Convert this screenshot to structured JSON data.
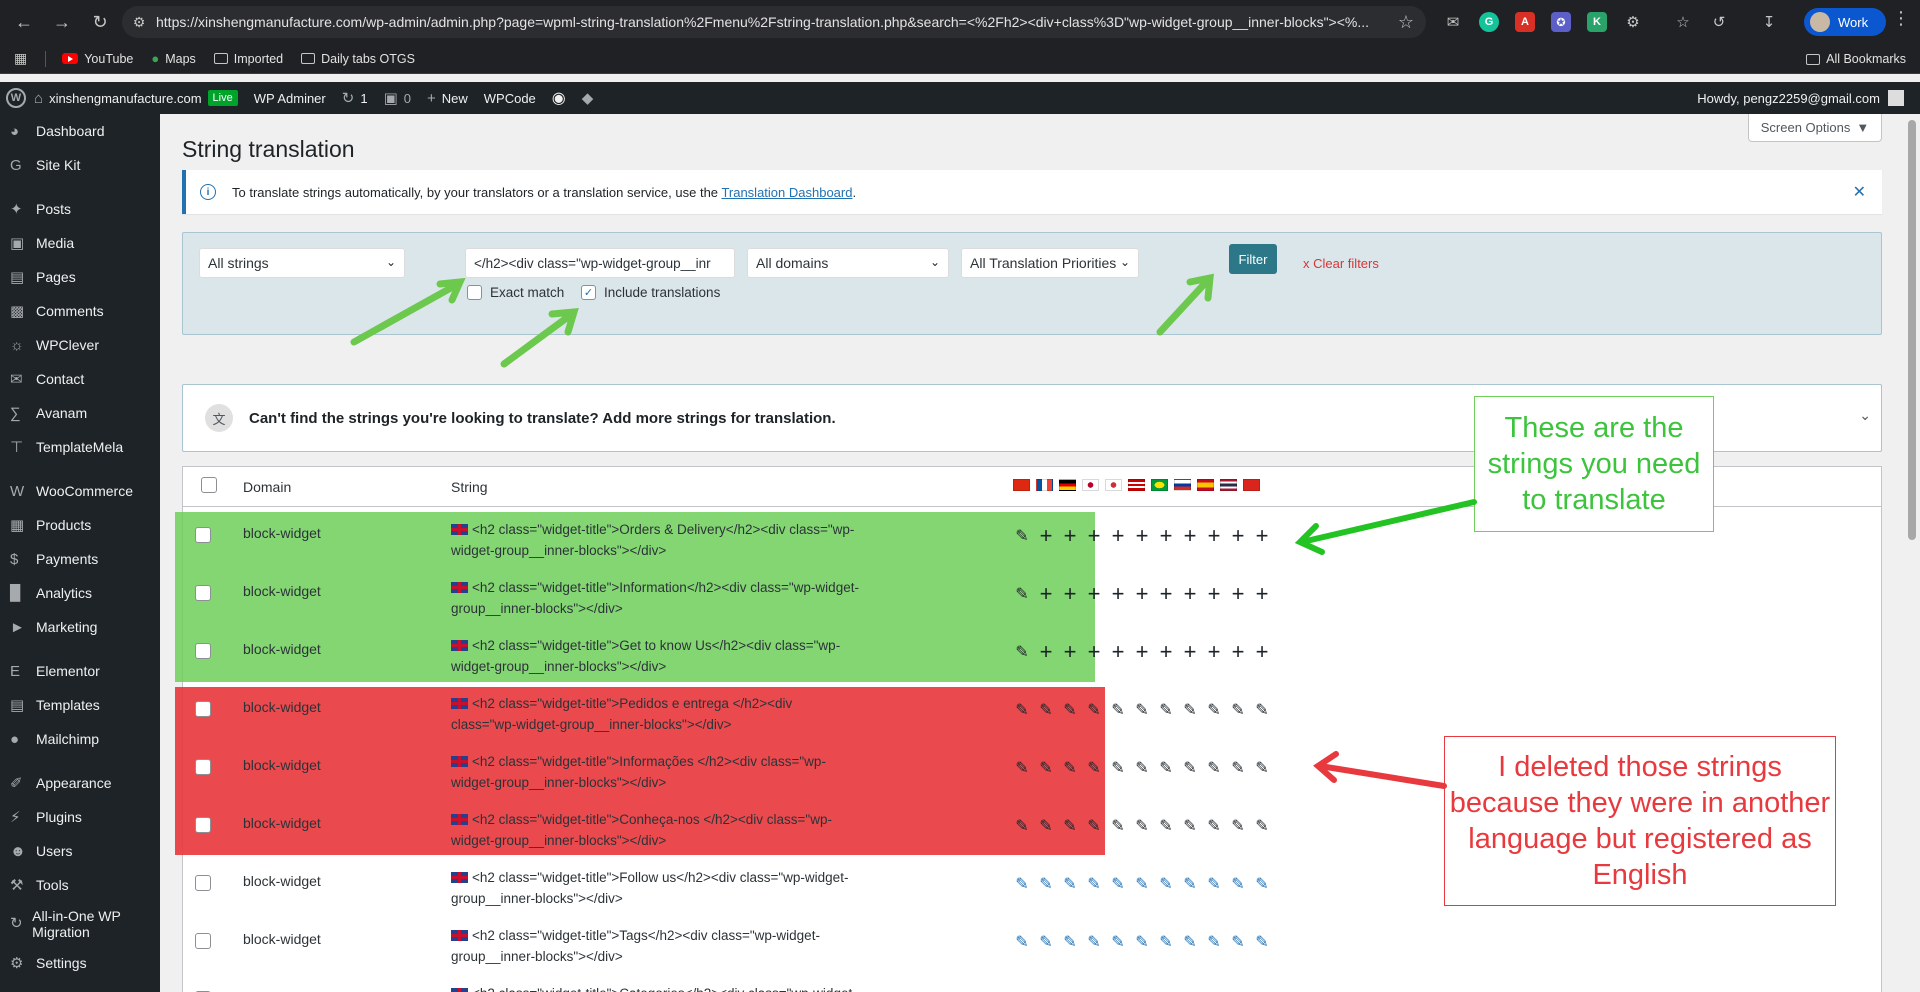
{
  "browser": {
    "url": "https://xinshengmanufacture.com/wp-admin/admin.php?page=wpml-string-translation%2Fmenu%2Fstring-translation.php&search=<%2Fh2><div+class%3D\"wp-widget-group__inner-blocks\"><%...",
    "profile_label": "Work",
    "bookmarks": [
      "YouTube",
      "Maps",
      "Imported",
      "Daily tabs OTGS"
    ],
    "all_bookmarks": "All Bookmarks"
  },
  "adminbar": {
    "site": "xinshengmanufacture.com",
    "live": "Live",
    "wp_adminer": "WP Adminer",
    "updates_count": "1",
    "comments_count": "0",
    "new_label": "New",
    "wpcode": "WPCode",
    "howdy": "Howdy, pengz2259@gmail.com"
  },
  "sidebar": {
    "items": [
      {
        "label": "Dashboard",
        "icon": "dashboard-icon"
      },
      {
        "label": "Site Kit",
        "icon": "sitekit-icon"
      },
      {
        "label": "Posts",
        "icon": "pin-icon"
      },
      {
        "label": "Media",
        "icon": "media-icon"
      },
      {
        "label": "Pages",
        "icon": "pages-icon"
      },
      {
        "label": "Comments",
        "icon": "comment-icon"
      },
      {
        "label": "WPClever",
        "icon": "lightbulb-icon"
      },
      {
        "label": "Contact",
        "icon": "mail-icon"
      },
      {
        "label": "Avanam",
        "icon": "avanam-icon"
      },
      {
        "label": "TemplateMela",
        "icon": "templatemela-icon"
      },
      {
        "label": "WooCommerce",
        "icon": "woo-icon"
      },
      {
        "label": "Products",
        "icon": "products-icon"
      },
      {
        "label": "Payments",
        "icon": "payments-icon"
      },
      {
        "label": "Analytics",
        "icon": "analytics-icon"
      },
      {
        "label": "Marketing",
        "icon": "megaphone-icon"
      },
      {
        "label": "Elementor",
        "icon": "elementor-icon"
      },
      {
        "label": "Templates",
        "icon": "folder-icon"
      },
      {
        "label": "Mailchimp",
        "icon": "mailchimp-icon"
      },
      {
        "label": "Appearance",
        "icon": "brush-icon"
      },
      {
        "label": "Plugins",
        "icon": "plugin-icon"
      },
      {
        "label": "Users",
        "icon": "user-icon"
      },
      {
        "label": "Tools",
        "icon": "wrench-icon"
      },
      {
        "label": "All-in-One WP Migration",
        "icon": "migration-icon"
      },
      {
        "label": "Settings",
        "icon": "settings-icon"
      }
    ]
  },
  "main": {
    "screen_options": "Screen Options",
    "title": "String translation",
    "notice": {
      "text": "To translate strings automatically, by your translators or a translation service, use the",
      "link": "Translation Dashboard",
      "end": "."
    },
    "filters": {
      "strings_select": "All strings",
      "search_value": "</h2><div class=\"wp-widget-group__inr",
      "domains_select": "All domains",
      "priority_select": "All Translation Priorities",
      "filter_button": "Filter",
      "clear_filters": "Clear filters",
      "exact_match": "Exact match",
      "exact_match_checked": false,
      "include_translations": "Include translations",
      "include_translations_checked": true
    },
    "addmore": "Can't find the strings you're looking to translate? Add more strings for translation.",
    "table": {
      "col_domain": "Domain",
      "col_string": "String",
      "flags": [
        "cn",
        "fr",
        "de",
        "jp",
        "kr",
        "my",
        "br",
        "ru",
        "es",
        "th",
        "vn"
      ],
      "rows": [
        {
          "domain": "block-widget",
          "string": "<h2 class=\"widget-title\">Orders & Delivery</h2><div class=\"wp-widget-group__inner-blocks\"></div>",
          "status": "untranslated"
        },
        {
          "domain": "block-widget",
          "string": "<h2 class=\"widget-title\">Information</h2><div class=\"wp-widget-group__inner-blocks\"></div>",
          "status": "untranslated"
        },
        {
          "domain": "block-widget",
          "string": "<h2 class=\"widget-title\">Get to know Us</h2><div class=\"wp-widget-group__inner-blocks\"></div>",
          "status": "untranslated"
        },
        {
          "domain": "block-widget",
          "string": "<h2 class=\"widget-title\">Pedidos e entrega </h2><div class=\"wp-widget-group__inner-blocks\"></div>",
          "status": "deleted"
        },
        {
          "domain": "block-widget",
          "string": "<h2 class=\"widget-title\">Informações </h2><div class=\"wp-widget-group__inner-blocks\"></div>",
          "status": "deleted"
        },
        {
          "domain": "block-widget",
          "string": "<h2 class=\"widget-title\">Conheça-nos </h2><div class=\"wp-widget-group__inner-blocks\"></div>",
          "status": "deleted"
        },
        {
          "domain": "block-widget",
          "string": "<h2 class=\"widget-title\">Follow us</h2><div class=\"wp-widget-group__inner-blocks\"></div>",
          "status": "translated"
        },
        {
          "domain": "block-widget",
          "string": "<h2 class=\"widget-title\">Tags</h2><div class=\"wp-widget-group__inner-blocks\"></div>",
          "status": "translated"
        },
        {
          "domain": "block-widget",
          "string": "<h2 class=\"widget-title\">Categories</h2><div class=\"wp-widget-",
          "status": "translated"
        }
      ]
    }
  },
  "annotations": {
    "green": "These are the strings you need to translate",
    "red": "I deleted those strings because they were in another language but registered as English",
    "green_color": "#3cc43c",
    "red_color": "#e8393e"
  }
}
